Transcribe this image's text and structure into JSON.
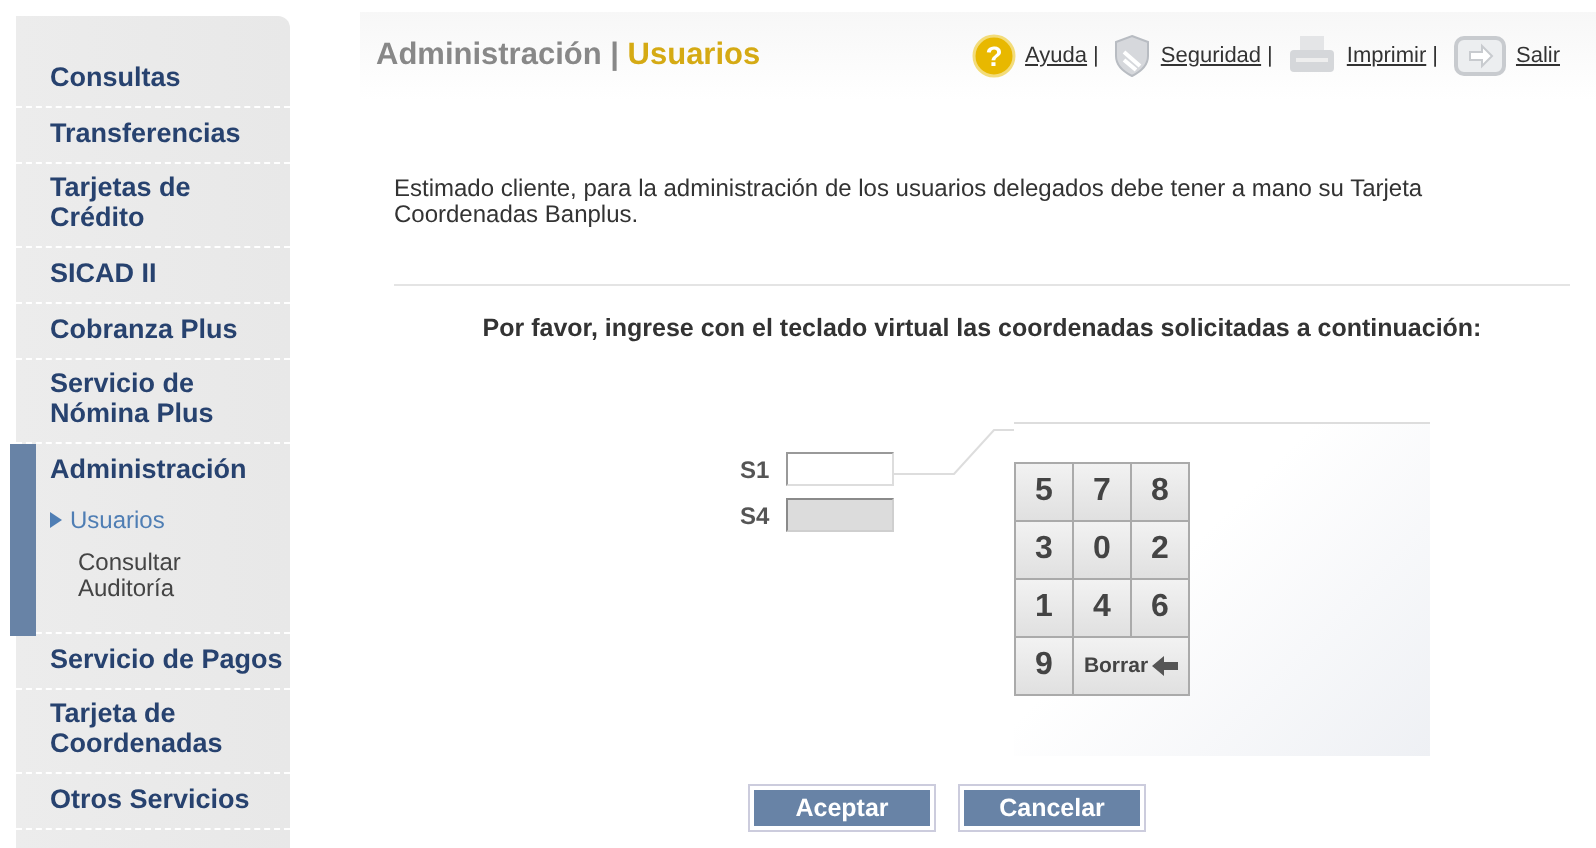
{
  "sidebar": {
    "items": [
      {
        "label": "Consultas",
        "expanded": false
      },
      {
        "label": "Transferencias",
        "expanded": false
      },
      {
        "label": "Tarjetas de Crédito",
        "expanded": false
      },
      {
        "label": "SICAD II",
        "expanded": false
      },
      {
        "label": "Cobranza Plus",
        "expanded": false
      },
      {
        "label": "Servicio de Nómina Plus",
        "expanded": false
      },
      {
        "label": "Administración",
        "expanded": true,
        "children": [
          {
            "label": "Usuarios",
            "selected": true
          },
          {
            "label": "Consultar Auditoría",
            "selected": false
          }
        ]
      },
      {
        "label": "Servicio de Pagos",
        "expanded": false
      },
      {
        "label": "Tarjeta de Coordenadas",
        "expanded": false
      },
      {
        "label": "Otros Servicios",
        "expanded": false
      }
    ]
  },
  "header": {
    "section": "Administración",
    "separator": "|",
    "page": "Usuarios",
    "links": [
      {
        "label": "Ayuda",
        "kind": "help",
        "glyph": "?"
      },
      {
        "label": "Seguridad",
        "kind": "shield"
      },
      {
        "label": "Imprimir",
        "kind": "printer"
      },
      {
        "label": "Salir",
        "kind": "exit"
      }
    ],
    "link_separator": "|"
  },
  "intro": "Estimado cliente, para la administración de los usuarios delegados debe tener a mano su Tarjeta Coordenadas Banplus.",
  "instruction": "Por favor, ingrese con el teclado virtual las coordenadas solicitadas a continuación:",
  "fields": [
    {
      "label": "S1",
      "disabled": false
    },
    {
      "label": "S4",
      "disabled": true
    }
  ],
  "keypad": {
    "keys": [
      {
        "label": "5",
        "kind": "digit"
      },
      {
        "label": "7",
        "kind": "digit"
      },
      {
        "label": "8",
        "kind": "digit"
      },
      {
        "label": "3",
        "kind": "digit"
      },
      {
        "label": "0",
        "kind": "digit"
      },
      {
        "label": "2",
        "kind": "digit"
      },
      {
        "label": "1",
        "kind": "digit"
      },
      {
        "label": "4",
        "kind": "digit"
      },
      {
        "label": "6",
        "kind": "digit"
      },
      {
        "label": "9",
        "kind": "digit"
      },
      {
        "label": "Borrar",
        "kind": "erase"
      }
    ]
  },
  "buttons": [
    "Aceptar",
    "Cancelar"
  ]
}
